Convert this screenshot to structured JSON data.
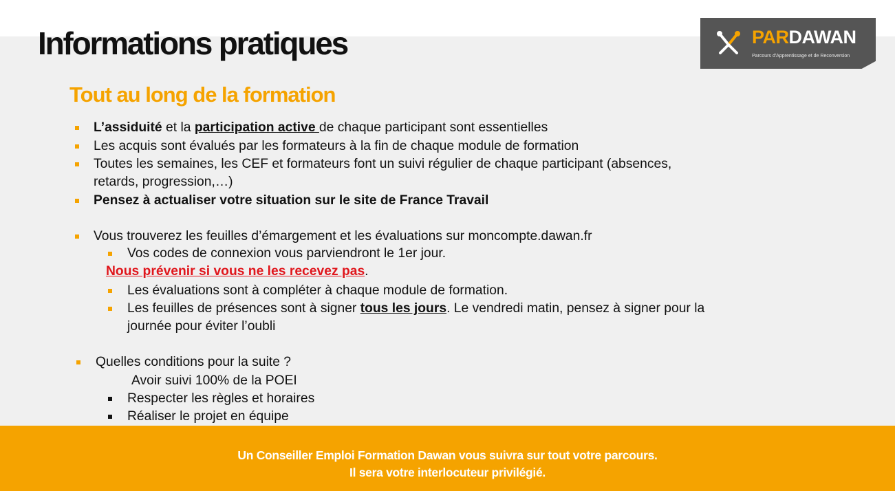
{
  "header": {
    "title": "Informations pratiques",
    "logo": {
      "brand_part1": "PAR",
      "brand_part2": "DAWAN",
      "tagline": "Parcours d'Apprentissage et de Reconversion",
      "icon": "pardawan-logo-icon"
    }
  },
  "section": {
    "heading": "Tout au long de la formation",
    "items": [
      {
        "bold": "L’assiduité",
        "mid": " et la ",
        "underline": "participation active ",
        "tail": "de chaque participant sont essentielles"
      },
      {
        "text": "Les acquis sont évalués par les formateurs à la fin de chaque module de formation"
      },
      {
        "line1": "Toutes les semaines, les CEF et formateurs font un suivi régulier de chaque participant (absences,",
        "line2": "retards, progression,…)"
      },
      {
        "bold": "Pensez à actualiser votre situation sur le site de France Travail"
      },
      {
        "text": "Vous trouverez les feuilles d’émargement et les évaluations sur moncompte.dawan.fr"
      }
    ],
    "sub_items": [
      {
        "text": "Vos codes de connexion vous parviendront le 1er jour."
      },
      {
        "red": "Nous prévenir si vous ne les recevez pas",
        "tail": "."
      },
      {
        "text": "Les évaluations sont à compléter à chaque module de formation."
      },
      {
        "pre": "Les feuilles de présences sont à signer ",
        "underline": "tous les jours",
        "post": ". Le vendredi matin, pensez à signer pour la",
        "line2": "journée pour éviter l’oubli"
      }
    ],
    "conditions": {
      "question": "Quelles conditions pour la suite ?",
      "intro": "Avoir suivi 100% de la POEI",
      "items": [
        "Respecter les règles et horaires",
        "Réaliser le projet en équipe"
      ]
    }
  },
  "footer": {
    "line1": "Un Conseiller Emploi Formation Dawan vous suivra sur tout votre parcours.",
    "line2": "Il sera votre interlocuteur privilégié."
  },
  "colors": {
    "accent": "#f5a300",
    "logo_bg": "#555555",
    "alert": "#e0161c",
    "slide_bg": "#f0f0f0"
  }
}
